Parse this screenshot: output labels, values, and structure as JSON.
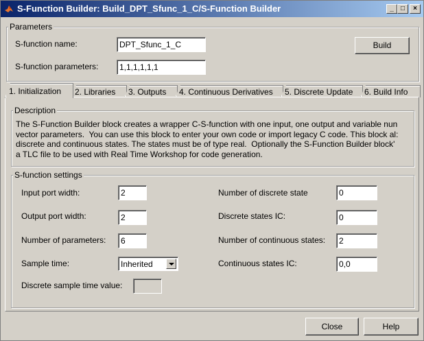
{
  "window": {
    "title": "S-Function Builder: Build_DPT_Sfunc_1_C/S-Function Builder"
  },
  "titlebar_buttons": {
    "minimize": "_",
    "maximize": "□",
    "close": "×"
  },
  "parameters": {
    "legend": "Parameters",
    "name_label": "S-function name:",
    "name_value": "DPT_Sfunc_1_C",
    "params_label": "S-function parameters:",
    "params_value": "1,1,1,1,1,1",
    "build_label": "Build"
  },
  "tabs": [
    {
      "label": "1. Initialization"
    },
    {
      "label": "2. Libraries"
    },
    {
      "label": "3. Outputs"
    },
    {
      "label": "4. Continuous Derivatives"
    },
    {
      "label": "5. Discrete Update"
    },
    {
      "label": "6. Build Info"
    }
  ],
  "description": {
    "legend": "Description",
    "text": "The S-Function Builder block creates a wrapper C-S-function with one input, one output and variable nun\nvector parameters.  You can use this block to enter your own code or import legacy C code. This block al:\ndiscrete and continuous states. The states must be of type real.  Optionally the S-Function Builder block'\na TLC file to be used with Real Time Workshop for code generation."
  },
  "settings": {
    "legend": "S-function settings",
    "input_width_label": "Input port width:",
    "input_width_value": "2",
    "output_width_label": "Output port width:",
    "output_width_value": "2",
    "num_params_label": "Number of parameters:",
    "num_params_value": "6",
    "sample_time_label": "Sample time:",
    "sample_time_value": "Inherited",
    "discrete_sample_label": "Discrete sample time value:",
    "discrete_sample_value": "",
    "num_discrete_label": "Number of discrete state",
    "num_discrete_value": "0",
    "discrete_ic_label": "Discrete states IC:",
    "discrete_ic_value": "0",
    "num_continuous_label": "Number of continuous states:",
    "num_continuous_value": "2",
    "continuous_ic_label": "Continuous states IC:",
    "continuous_ic_value": "0,0"
  },
  "footer": {
    "close_label": "Close",
    "help_label": "Help"
  }
}
